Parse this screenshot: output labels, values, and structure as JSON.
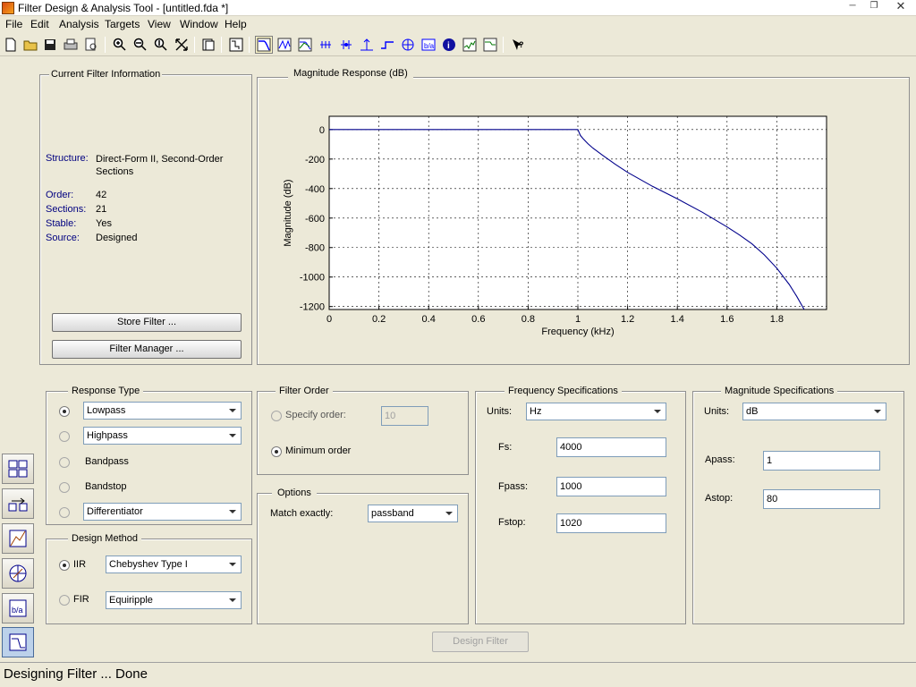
{
  "window": {
    "title": "Filter Design & Analysis Tool -  [untitled.fda *]"
  },
  "menu": [
    "File",
    "Edit",
    "Analysis",
    "Targets",
    "View",
    "Window",
    "Help"
  ],
  "toolbar_icons": [
    "new-icon",
    "open-icon",
    "save-icon",
    "print-icon",
    "print-preview-icon",
    "zoom-in-icon",
    "zoom-x-icon",
    "zoom-y-icon",
    "full-view-icon",
    "new-figure-icon",
    "filter-specs-icon",
    "magnitude-response-icon",
    "phase-response-icon",
    "mag-phase-icon",
    "group-delay-icon",
    "phase-delay-icon",
    "impulse-response-icon",
    "step-response-icon",
    "pole-zero-icon",
    "coefficients-icon",
    "filter-info-icon",
    "noise-icon",
    "whats-this-icon"
  ],
  "current_filter": {
    "title": "Current Filter Information",
    "structure_label": "Structure:",
    "structure_value": "Direct-Form II, Second-Order Sections",
    "order_label": "Order:",
    "order_value": "42",
    "sections_label": "Sections:",
    "sections_value": "21",
    "stable_label": "Stable:",
    "stable_value": "Yes",
    "source_label": "Source:",
    "source_value": "Designed",
    "store_button": "Store Filter ...",
    "manager_button": "Filter Manager ..."
  },
  "chart_data": {
    "type": "line",
    "title": "Magnitude Response (dB)",
    "xlabel": "Frequency (kHz)",
    "ylabel": "Magnitude (dB)",
    "xlim": [
      0,
      2
    ],
    "ylim": [
      -1220,
      90
    ],
    "xticks": [
      "0",
      "0.2",
      "0.4",
      "0.6",
      "0.8",
      "1",
      "1.2",
      "1.4",
      "1.6",
      "1.8"
    ],
    "yticks": [
      "0",
      "-200",
      "-400",
      "-600",
      "-800",
      "-1000",
      "-1200"
    ],
    "grid": true,
    "series": [
      {
        "color": "#00008b",
        "x": [
          0,
          0.5,
          1.0,
          1.005,
          1.01,
          1.02,
          1.04,
          1.06,
          1.1,
          1.15,
          1.2,
          1.3,
          1.4,
          1.5,
          1.6,
          1.65,
          1.7,
          1.75,
          1.8,
          1.85,
          1.88,
          1.91
        ],
        "y": [
          0,
          0,
          0,
          -20,
          -40,
          -60,
          -95,
          -125,
          -175,
          -235,
          -290,
          -385,
          -470,
          -560,
          -660,
          -715,
          -775,
          -850,
          -940,
          -1050,
          -1130,
          -1220
        ]
      }
    ]
  },
  "response_type": {
    "title": "Response Type",
    "options": [
      {
        "label": "Lowpass",
        "kind": "combo"
      },
      {
        "label": "Highpass",
        "kind": "combo"
      },
      {
        "label": "Bandpass",
        "kind": "text"
      },
      {
        "label": "Bandstop",
        "kind": "text"
      },
      {
        "label": "Differentiator",
        "kind": "combo"
      }
    ]
  },
  "design_method": {
    "title": "Design Method",
    "iir_label": "IIR",
    "iir_value": "Chebyshev Type I",
    "fir_label": "FIR",
    "fir_value": "Equiripple"
  },
  "filter_order": {
    "title": "Filter Order",
    "specify_label": "Specify order:",
    "specify_value": "10",
    "minimum_label": "Minimum order"
  },
  "options": {
    "title": "Options",
    "match_label": "Match exactly:",
    "match_value": "passband"
  },
  "freq_specs": {
    "title": "Frequency Specifications",
    "units_label": "Units:",
    "units_value": "Hz",
    "fs_label": "Fs:",
    "fs_value": "4000",
    "fpass_label": "Fpass:",
    "fpass_value": "1000",
    "fstop_label": "Fstop:",
    "fstop_value": "1020"
  },
  "mag_specs": {
    "title": "Magnitude Specifications",
    "units_label": "Units:",
    "units_value": "dB",
    "apass_label": "Apass:",
    "apass_value": "1",
    "astop_label": "Astop:",
    "astop_value": "80"
  },
  "design_button": "Design Filter",
  "status": "Designing Filter ... Done",
  "left_panel_icons": [
    "pole-zero-editor-icon",
    "transform-filter-icon",
    "realize-model-icon",
    "quantize-icon",
    "import-filter-icon",
    "design-filter-icon"
  ]
}
